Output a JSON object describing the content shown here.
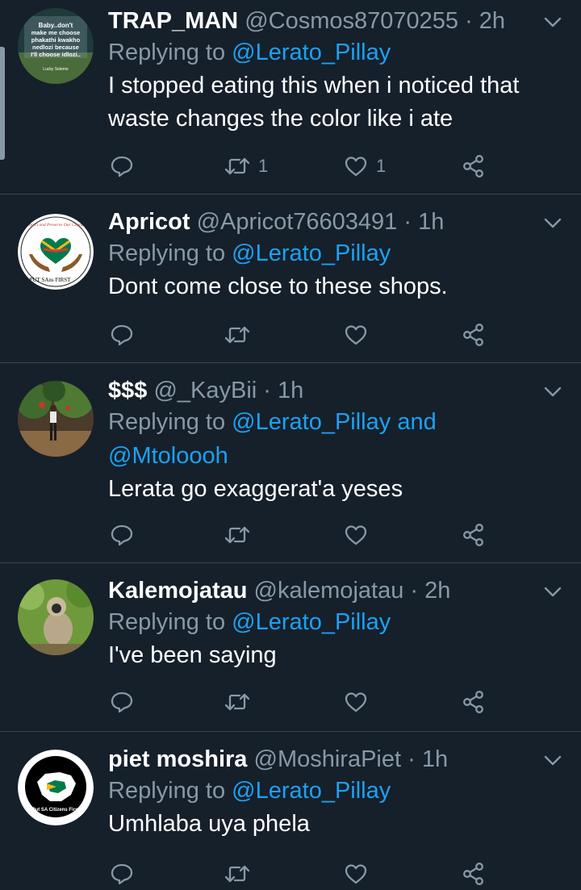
{
  "tweets": [
    {
      "name": "TRAP_MAN",
      "handle": "@Cosmos87070255",
      "time": "· 2h",
      "replying_prefix": "Replying to ",
      "replying_to": [
        "@Lerato_Pillay"
      ],
      "text": "I stopped eating this when i noticed that waste changes the color like i ate",
      "retweets": "1",
      "likes": "1",
      "avatar_text": [
        "Baby..don't",
        "make me choose",
        "phakathi kwakho",
        "nedlozi because",
        "I'll choose idlozi..",
        "Lucky Selemo"
      ]
    },
    {
      "name": "Apricot",
      "handle": "@Apricot76603491",
      "time": "· 1h",
      "replying_prefix": "Replying to ",
      "replying_to": [
        "@Lerato_Pillay"
      ],
      "text": "Dont come close to these shops.",
      "retweets": "",
      "likes": "",
      "avatar_text": [
        "Protect and Preserve Our Country",
        "PUT SAns FIRST"
      ]
    },
    {
      "name": "$$$",
      "handle": "@_KayBii",
      "time": "· 1h",
      "replying_prefix": "Replying to ",
      "replying_to": [
        "@Lerato_Pillay",
        "@Mtoloooh"
      ],
      "joiner": " and",
      "text": "Lerata go exaggerat'a yeses",
      "retweets": "",
      "likes": ""
    },
    {
      "name": "Kalemojatau",
      "handle": "@kalemojatau",
      "time": "· 2h",
      "replying_prefix": "Replying to ",
      "replying_to": [
        "@Lerato_Pillay"
      ],
      "text": "I've been saying",
      "retweets": "",
      "likes": ""
    },
    {
      "name": "piet moshira",
      "handle": "@MoshiraPiet",
      "time": "· 1h",
      "replying_prefix": "Replying to ",
      "replying_to": [
        "@Lerato_Pillay"
      ],
      "text": "Umhlaba uya phela",
      "retweets": "",
      "likes": "",
      "avatar_text": [
        "Put SA Citizens First"
      ]
    }
  ],
  "icons": {
    "reply": "reply-icon",
    "retweet": "retweet-icon",
    "like": "heart-icon",
    "share": "share-icon",
    "menu": "chevron-down-icon"
  },
  "colors": {
    "background": "#15202b",
    "divider": "#38444d",
    "secondary_text": "#8899a6",
    "mention": "#1da1f2",
    "primary_text": "#ffffff"
  }
}
